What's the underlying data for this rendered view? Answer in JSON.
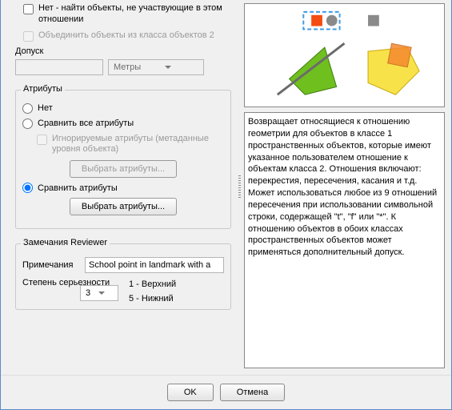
{
  "checks": {
    "not_find": {
      "label": "Нет - найти объекты, не участвующие в этом отношении",
      "disabled": false
    },
    "merge": {
      "label": "Объединить объекты из класса объектов 2",
      "disabled": true
    }
  },
  "tolerance": {
    "label": "Допуск",
    "units_selected": "Метры"
  },
  "attributes": {
    "group_label": "Атрибуты",
    "radio_none": "Нет",
    "radio_compare_all": "Сравнить все атрибуты",
    "ignored_check": "Игнорируемые атрибуты (метаданные уровня объекта)",
    "select_attrs_btn": "Выбрать атрибуты...",
    "radio_compare_sel": "Сравнить атрибуты",
    "selected": "compare_sel"
  },
  "reviewer": {
    "group_label": "Замечания Reviewer",
    "notes_label": "Примечания",
    "notes_value": "School point in landmark with a",
    "severity_label": "Степень серьезности",
    "severity_value": "3",
    "sev_top": "1 - Верхний",
    "sev_bottom": "5 - Нижний"
  },
  "description": "Возвращает относящиеся к отношению геометрии для объектов в классе 1 пространственных объектов, которые имеют указанное пользователем отношение к объектам класса 2. Отношения включают: перекрестия, пересечения, касания и т.д. Может использоваться любое из 9 отношений пересечения при использовании символьной строки, содержащей \"t\", \"f\" или \"*\". К отношению объектов в обоих классах пространственных объектов может применяться дополнительный допуск.",
  "footer": {
    "ok": "OK",
    "cancel": "Отмена"
  },
  "icons": {
    "red_square": "red-square-icon",
    "grey_circle": "grey-circle-icon",
    "grey_square": "grey-square-icon"
  }
}
